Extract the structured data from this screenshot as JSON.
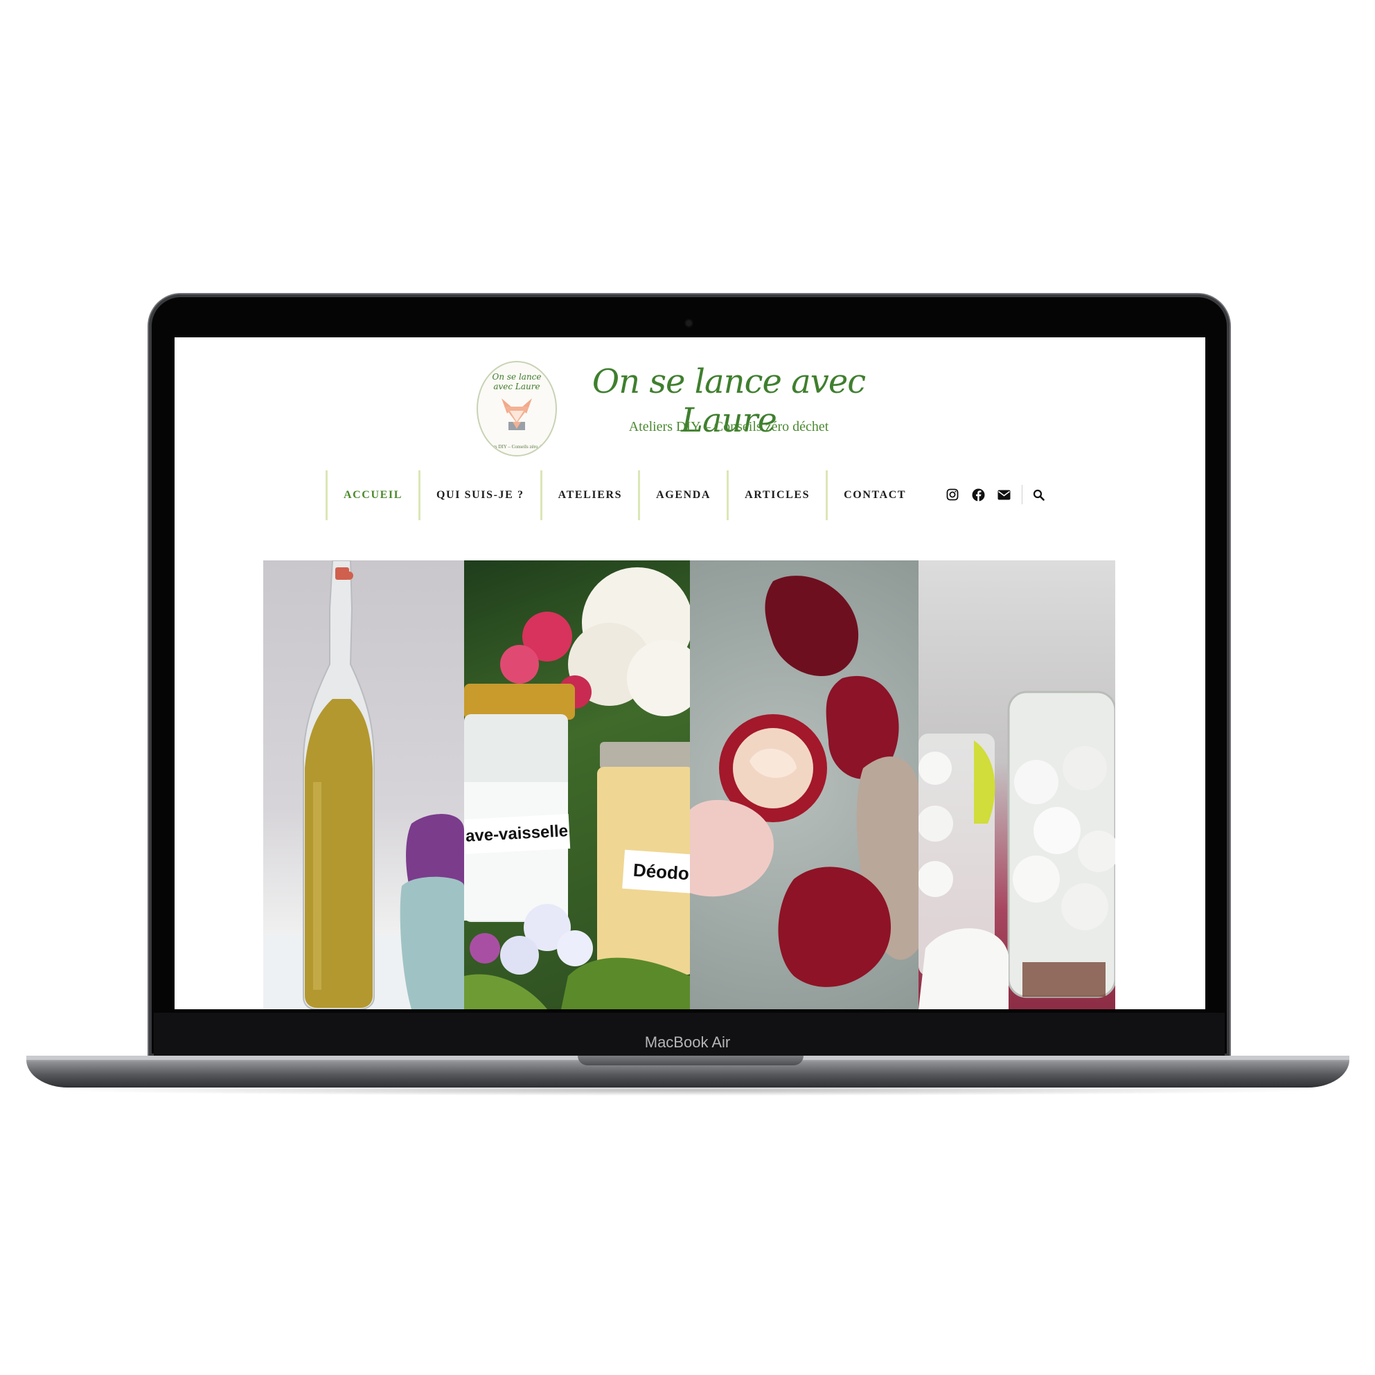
{
  "device": {
    "label": "MacBook Air"
  },
  "site": {
    "title": "On se lance avec Laure",
    "tagline": "Ateliers DIY – Conseils zéro déchet",
    "logo": {
      "script_line1": "On se lance",
      "script_line2": "avec Laure",
      "ring_text": "Ateliers DIY – Conseils zéro déchet"
    },
    "accent_color": "#4a8a2c",
    "divider_color": "#dbe7b6"
  },
  "nav": {
    "items": [
      {
        "label": "ACCUEIL",
        "active": true
      },
      {
        "label": "QUI SUIS-JE ?"
      },
      {
        "label": "ATELIERS"
      },
      {
        "label": "AGENDA"
      },
      {
        "label": "ARTICLES"
      },
      {
        "label": "CONTACT"
      }
    ],
    "icons": [
      "instagram-icon",
      "facebook-icon",
      "envelope-icon",
      "search-icon"
    ]
  },
  "gallery": {
    "panels": [
      {
        "name": "bottle"
      },
      {
        "name": "jars",
        "labels": [
          "ave-vaisselle",
          "Déodo"
        ]
      },
      {
        "name": "cream"
      },
      {
        "name": "tablets"
      }
    ]
  }
}
